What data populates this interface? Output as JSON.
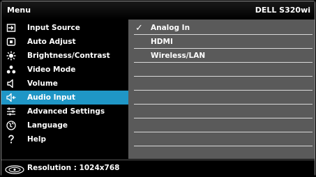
{
  "header": {
    "title": "Menu",
    "model": "DELL S320wi"
  },
  "menu": {
    "items": [
      {
        "label": "Input Source",
        "icon": "input-source-icon"
      },
      {
        "label": "Auto Adjust",
        "icon": "auto-adjust-icon"
      },
      {
        "label": "Brightness/Contrast",
        "icon": "brightness-icon"
      },
      {
        "label": "Video Mode",
        "icon": "video-mode-icon"
      },
      {
        "label": "Volume",
        "icon": "speaker-icon"
      },
      {
        "label": "Audio Input",
        "icon": "audio-input-icon",
        "selected": true
      },
      {
        "label": "Advanced Settings",
        "icon": "sliders-icon"
      },
      {
        "label": "Language",
        "icon": "globe-icon"
      },
      {
        "label": "Help",
        "icon": "question-icon"
      }
    ]
  },
  "panel": {
    "options": [
      {
        "label": "Analog In",
        "checked": true,
        "check_mark": "✓"
      },
      {
        "label": "HDMI",
        "checked": false
      },
      {
        "label": "Wireless/LAN",
        "checked": false
      }
    ]
  },
  "footer": {
    "resolution_text": "Resolution : 1024x768",
    "icon": "resolution-icon"
  },
  "colors": {
    "selected": "#1f96c6",
    "panel": "#5a5a5a",
    "background": "#000000",
    "text": "#ffffff"
  }
}
